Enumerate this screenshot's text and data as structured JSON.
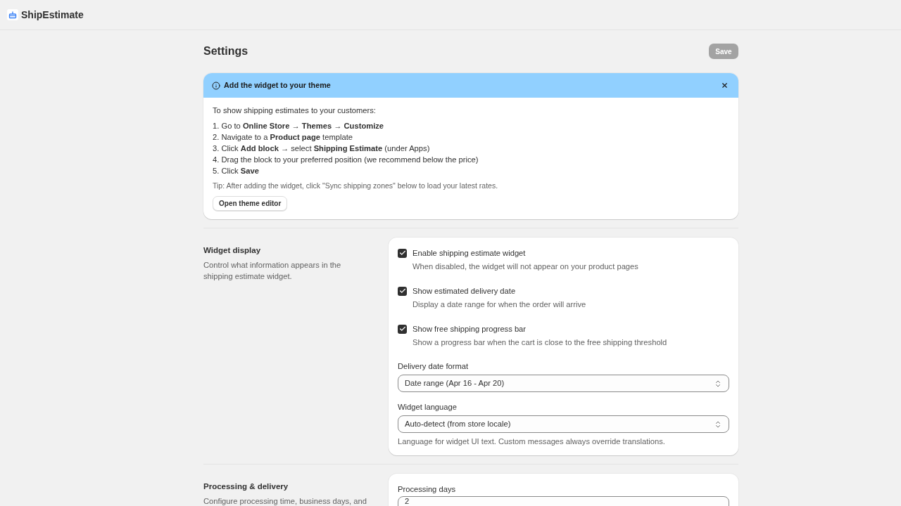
{
  "app": {
    "title": "ShipEstimate"
  },
  "page": {
    "title": "Settings",
    "save_button": {
      "label": "Save",
      "disabled": true
    }
  },
  "banner": {
    "title": "Add the widget to your theme",
    "intro": "To show shipping estimates to your customers:",
    "steps": [
      "1. Go to **Online Store → Themes → Customize**",
      "2. Navigate to a **Product page** template",
      "3. Click **Add block** → select **Shipping Estimate** (under Apps)",
      "4. Drag the block to your preferred position (we recommend below the price)",
      "5. Click **Save**"
    ],
    "tip": "Tip: After adding the widget, click \"Sync shipping zones\" below to load your latest rates.",
    "button": "Open theme editor"
  },
  "sections": [
    {
      "title": "Widget display",
      "description": "Control what information appears in the shipping estimate widget.",
      "fields": [
        {
          "kind": "checkbox",
          "label": "Enable shipping estimate widget",
          "help": "When disabled, the widget will not appear on your product pages",
          "checked": true
        },
        {
          "kind": "checkbox",
          "label": "Show estimated delivery date",
          "help": "Display a date range for when the order will arrive",
          "checked": true
        },
        {
          "kind": "checkbox",
          "label": "Show free shipping progress bar",
          "help": "Show a progress bar when the cart is close to the free shipping threshold",
          "checked": true
        },
        {
          "kind": "select",
          "label": "Delivery date format",
          "value": "Date range (Apr 16 - Apr 20)"
        },
        {
          "kind": "select",
          "label": "Widget language",
          "value": "Auto-detect (from store locale)",
          "help": "Language for widget UI text. Custom messages always override translations."
        }
      ]
    },
    {
      "title": "Processing & delivery",
      "description": "Configure processing time, business days, and",
      "fields": [
        {
          "kind": "text",
          "label": "Processing days",
          "value": "2"
        }
      ]
    }
  ]
}
